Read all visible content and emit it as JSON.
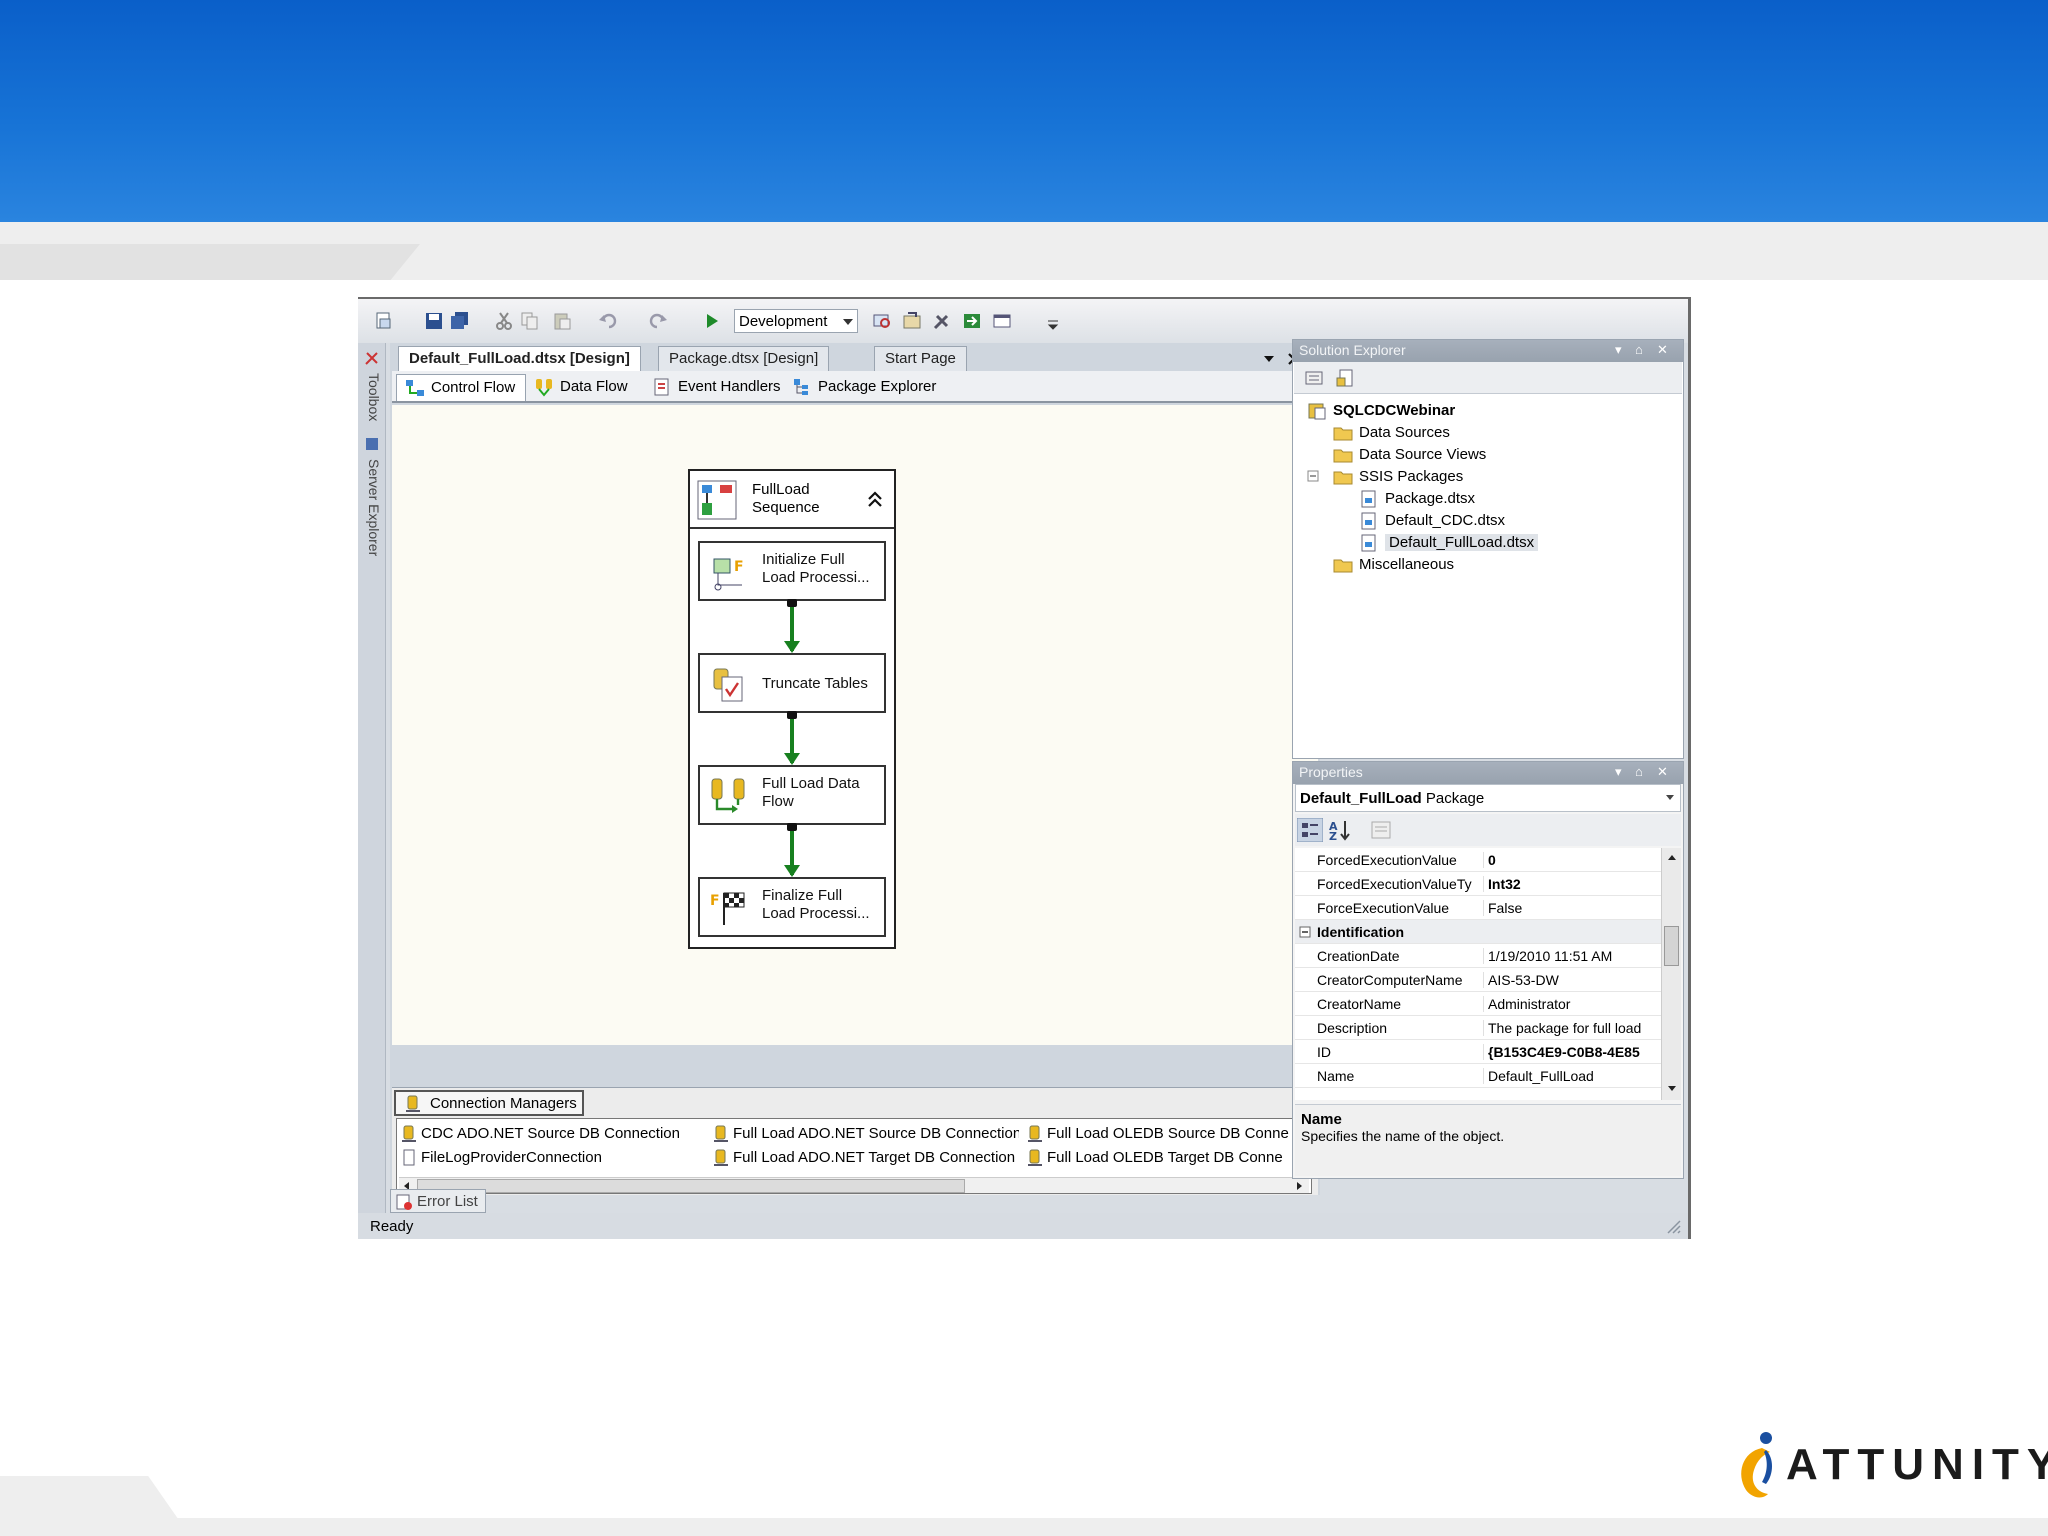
{
  "brand": {
    "logo_text": "ATTUNITY",
    "banner_color": "#1670d4"
  },
  "toolbar": {
    "config_value": "Development"
  },
  "leftrail": {
    "toolbox_label": "Toolbox",
    "server_explorer_label": "Server Explorer"
  },
  "doc_tabs": [
    {
      "label": "Default_FullLoad.dtsx [Design]",
      "active": true
    },
    {
      "label": "Package.dtsx [Design]",
      "active": false
    },
    {
      "label": "Start Page",
      "active": false
    }
  ],
  "designer_tabs": [
    {
      "label": "Control Flow",
      "active": true,
      "icon": "control-flow-icon"
    },
    {
      "label": "Data Flow",
      "active": false,
      "icon": "data-flow-icon"
    },
    {
      "label": "Event Handlers",
      "active": false,
      "icon": "event-handlers-icon"
    },
    {
      "label": "Package Explorer",
      "active": false,
      "icon": "package-explorer-icon"
    }
  ],
  "sequence": {
    "title_line1": "FullLoad",
    "title_line2": "Sequence",
    "tasks": [
      {
        "line1": "Initialize Full",
        "line2": "Load Processi...",
        "icon": "script-task-icon"
      },
      {
        "line1": "Truncate Tables",
        "line2": "",
        "icon": "sql-task-icon"
      },
      {
        "line1": "Full Load Data",
        "line2": "Flow",
        "icon": "data-flow-task-icon"
      },
      {
        "line1": "Finalize Full",
        "line2": "Load Processi...",
        "icon": "finish-flag-icon"
      }
    ],
    "connector_color": "#17801f"
  },
  "connection_managers": {
    "tab_label": "Connection Managers",
    "items": [
      "CDC ADO.NET Source DB Connection",
      "FileLogProviderConnection",
      "Full Load ADO.NET Source DB Connection",
      "Full Load ADO.NET Target DB Connection",
      "Full Load OLEDB Source DB Conne",
      "Full Load OLEDB Target DB Conne"
    ]
  },
  "error_list": {
    "label": "Error List"
  },
  "status": {
    "text": "Ready"
  },
  "solution_explorer": {
    "title": "Solution Explorer",
    "root": "SQLCDCWebinar",
    "items": [
      {
        "label": "Data Sources"
      },
      {
        "label": "Data Source Views"
      },
      {
        "label": "SSIS Packages"
      },
      {
        "label": "Package.dtsx"
      },
      {
        "label": "Default_CDC.dtsx"
      },
      {
        "label": "Default_FullLoad.dtsx",
        "selected": true
      },
      {
        "label": "Miscellaneous"
      }
    ]
  },
  "properties": {
    "title": "Properties",
    "object_name": "Default_FullLoad",
    "object_type": "Package",
    "rows": [
      {
        "key": "ForcedExecutionValue",
        "value": "0",
        "bold": true
      },
      {
        "key": "ForcedExecutionValueTy",
        "value": "Int32",
        "bold": true
      },
      {
        "key": "ForceExecutionValue",
        "value": "False"
      },
      {
        "key": "Identification",
        "value": "",
        "category": true
      },
      {
        "key": "CreationDate",
        "value": "1/19/2010 11:51 AM"
      },
      {
        "key": "CreatorComputerName",
        "value": "AIS-53-DW"
      },
      {
        "key": "CreatorName",
        "value": "Administrator"
      },
      {
        "key": "Description",
        "value": "The package for full load"
      },
      {
        "key": "ID",
        "value": "{B153C4E9-C0B8-4E85",
        "bold": true
      },
      {
        "key": "Name",
        "value": "Default_FullLoad"
      }
    ],
    "desc_title": "Name",
    "desc_text": "Specifies the name of the object."
  }
}
